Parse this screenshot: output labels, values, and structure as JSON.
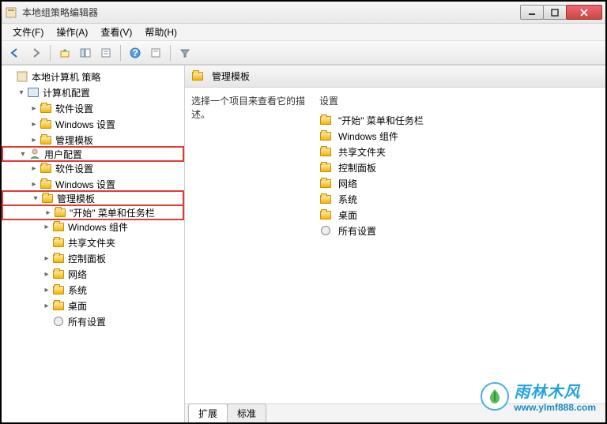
{
  "window": {
    "title": "本地组策略编辑器"
  },
  "menu": {
    "file": "文件(F)",
    "action": "操作(A)",
    "view": "查看(V)",
    "help": "帮助(H)"
  },
  "tree": {
    "root": "本地计算机 策略",
    "computer_config": "计算机配置",
    "cc_software": "软件设置",
    "cc_windows": "Windows 设置",
    "cc_admin": "管理模板",
    "user_config": "用户配置",
    "uc_software": "软件设置",
    "uc_windows": "Windows 设置",
    "uc_admin": "管理模板",
    "start_taskbar": "\"开始\" 菜单和任务栏",
    "win_components": "Windows 组件",
    "shared_folders": "共享文件夹",
    "control_panel": "控制面板",
    "network": "网络",
    "system": "系统",
    "desktop": "桌面",
    "all_settings": "所有设置"
  },
  "content": {
    "header": "管理模板",
    "description": "选择一个项目来查看它的描述。",
    "settings_header": "设置",
    "items": {
      "start_taskbar": "\"开始\" 菜单和任务栏",
      "win_components": "Windows 组件",
      "shared_folders": "共享文件夹",
      "control_panel": "控制面板",
      "network": "网络",
      "system": "系统",
      "desktop": "桌面",
      "all_settings": "所有设置"
    }
  },
  "tabs": {
    "extended": "扩展",
    "standard": "标准"
  },
  "watermark": {
    "brand": "雨林木风",
    "url": "www.ylmf888.com"
  }
}
